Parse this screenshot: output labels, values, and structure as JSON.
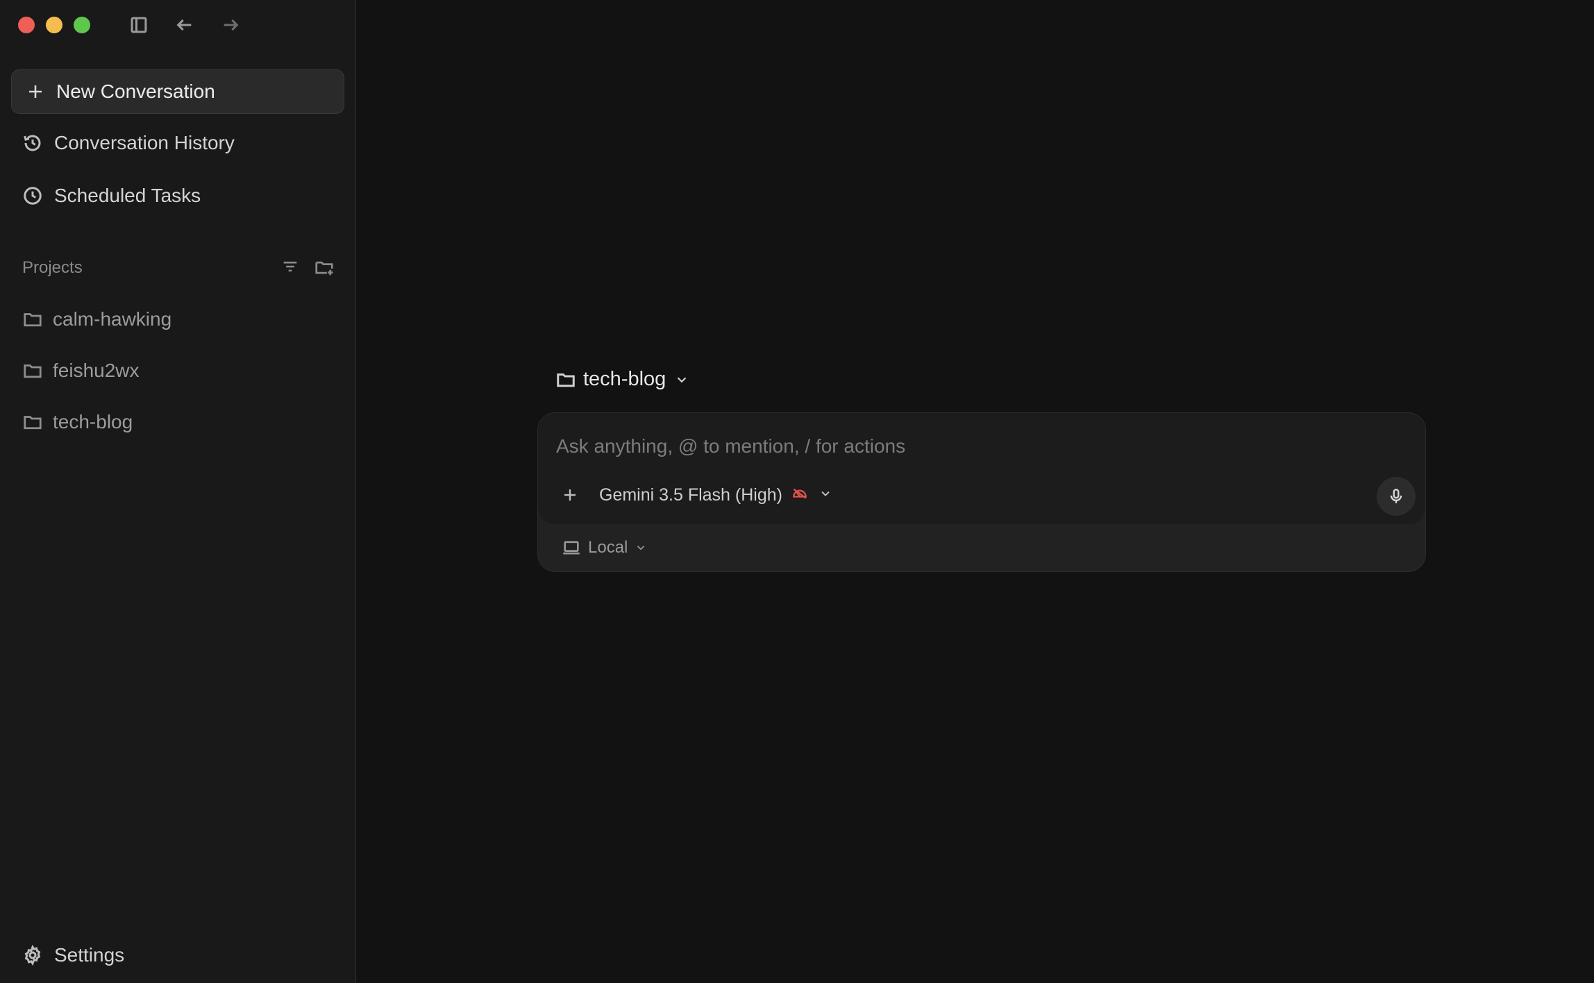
{
  "sidebar": {
    "new_conversation_label": "New Conversation",
    "nav": {
      "history_label": "Conversation History",
      "scheduled_label": "Scheduled Tasks"
    },
    "projects": {
      "label": "Projects",
      "items": [
        {
          "name": "calm-hawking"
        },
        {
          "name": "feishu2wx"
        },
        {
          "name": "tech-blog"
        }
      ]
    },
    "settings_label": "Settings"
  },
  "main": {
    "current_project": "tech-blog",
    "composer": {
      "placeholder": "Ask anything, @ to mention, / for actions",
      "value": "",
      "model_label": "Gemini 3.5 Flash (High)",
      "environment_label": "Local"
    }
  },
  "colors": {
    "background": "#121212",
    "sidebar": "#191919",
    "traffic_close": "#ee5f57",
    "traffic_minimize": "#f5bd4f",
    "traffic_maximize": "#5dc84c",
    "model_indicator": "#e0524a"
  },
  "icons": {
    "sidebar_toggle": "sidebar-toggle-icon",
    "back": "arrow-left-icon",
    "forward": "arrow-right-icon",
    "new": "plus-icon",
    "history": "history-icon",
    "scheduled": "clock-icon",
    "filter": "filter-icon",
    "new_folder": "folder-plus-icon",
    "folder": "folder-icon",
    "settings": "gear-icon",
    "mic": "mic-icon",
    "laptop": "laptop-icon",
    "gauge": "gauge-icon"
  }
}
